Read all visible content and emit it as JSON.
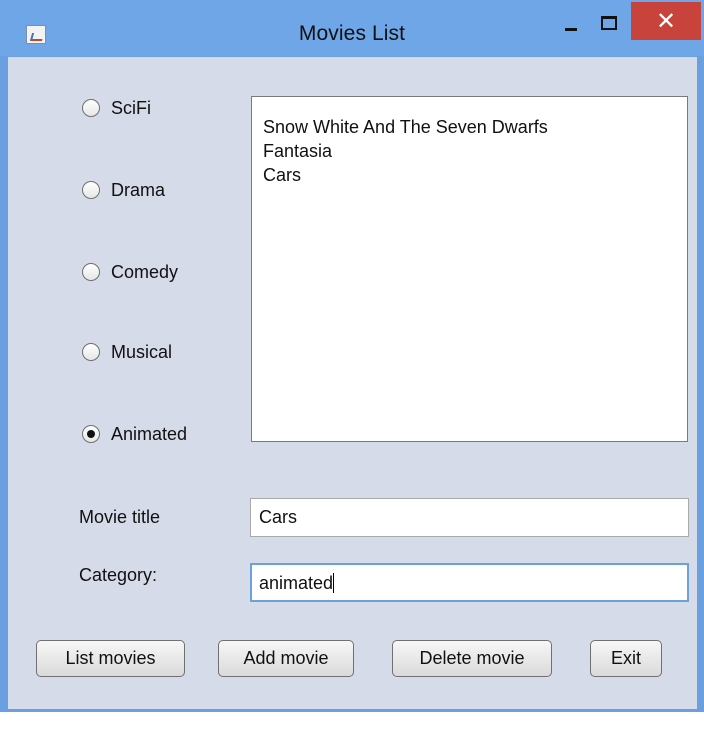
{
  "window": {
    "title": "Movies List",
    "icon": "java-app-icon",
    "controls": {
      "minimize": "minimize-icon",
      "maximize": "maximize-icon",
      "close": "close-icon",
      "close_glyph": "✕"
    }
  },
  "categories": [
    {
      "label": "SciFi",
      "checked": false
    },
    {
      "label": "Drama",
      "checked": false
    },
    {
      "label": "Comedy",
      "checked": false
    },
    {
      "label": "Musical",
      "checked": false
    },
    {
      "label": "Animated",
      "checked": true
    }
  ],
  "movies_list": [
    "Snow White And The Seven Dwarfs",
    "Fantasia",
    "Cars"
  ],
  "form": {
    "movie_title_label": "Movie title",
    "movie_title_value": "Cars",
    "category_label": "Category:",
    "category_value": "animated"
  },
  "buttons": {
    "list_movies": "List movies",
    "add_movie": "Add movie",
    "delete_movie": "Delete movie",
    "exit": "Exit"
  },
  "colors": {
    "titlebar": "#6ea6e8",
    "window_background": "#d6dbe9",
    "close_button": "#c7433b",
    "focus_border": "#6ba2dd"
  }
}
